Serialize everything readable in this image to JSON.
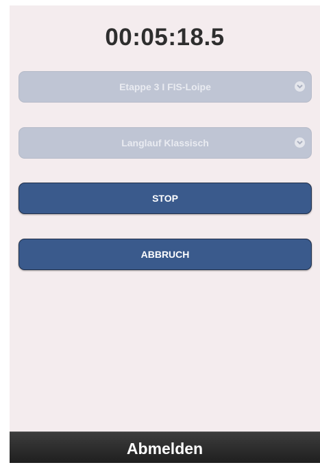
{
  "timer": {
    "value": "00:05:18.5"
  },
  "selects": {
    "stage": {
      "selected": "Etappe 3 I FIS-Loipe",
      "icon": "chevron-down-icon"
    },
    "discipline": {
      "selected": "Langlauf Klassisch",
      "icon": "chevron-down-icon"
    }
  },
  "buttons": {
    "stop_label": "STOP",
    "abbruch_label": "ABBRUCH"
  },
  "footer": {
    "logout_label": "Abmelden"
  },
  "colors": {
    "background": "#f4ecee",
    "button": "#3a5a8c",
    "select_disabled": "#bfc5d4",
    "footer": "#2b2b2b"
  }
}
